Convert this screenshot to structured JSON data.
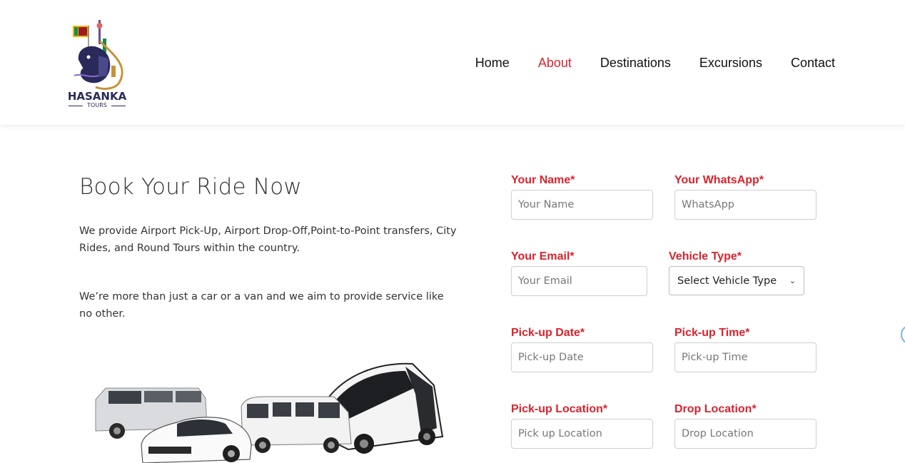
{
  "brand": {
    "name": "HASANKA",
    "sub": "TOURS"
  },
  "nav": {
    "items": [
      {
        "label": "Home",
        "active": false
      },
      {
        "label": "About",
        "active": true
      },
      {
        "label": "Destinations",
        "active": false
      },
      {
        "label": "Excursions",
        "active": false
      },
      {
        "label": "Contact",
        "active": false
      }
    ]
  },
  "hero": {
    "title": "Book Your Ride Now",
    "paragraph1": "We provide Airport Pick-Up, Airport Drop-Off,Point-to-Point transfers, City Rides, and Round Tours within the country.",
    "paragraph2": "We’re more than just a car or a van and we aim to provide service like no other."
  },
  "form": {
    "name": {
      "label": "Your Name*",
      "placeholder": "Your Name"
    },
    "whatsapp": {
      "label": "Your WhatsApp*",
      "placeholder": "WhatsApp"
    },
    "email": {
      "label": "Your Email*",
      "placeholder": "Your Email"
    },
    "vehicle": {
      "label": "Vehicle Type*",
      "selected": "Select Vehicle Type"
    },
    "pickup_date": {
      "label": "Pick-up Date*",
      "placeholder": "Pick-up Date"
    },
    "pickup_time": {
      "label": "Pick-up Time*",
      "placeholder": "Pick-up Time"
    },
    "pickup_location": {
      "label": "Pick-up Location*",
      "placeholder": "Pick up Location"
    },
    "drop_location": {
      "label": "Drop Location*",
      "placeholder": "Drop Location"
    }
  },
  "colors": {
    "accent": "#d9232d",
    "brand_navy": "#2a2a5a"
  },
  "icons": {
    "select_arrow": "chevron-down-icon"
  }
}
